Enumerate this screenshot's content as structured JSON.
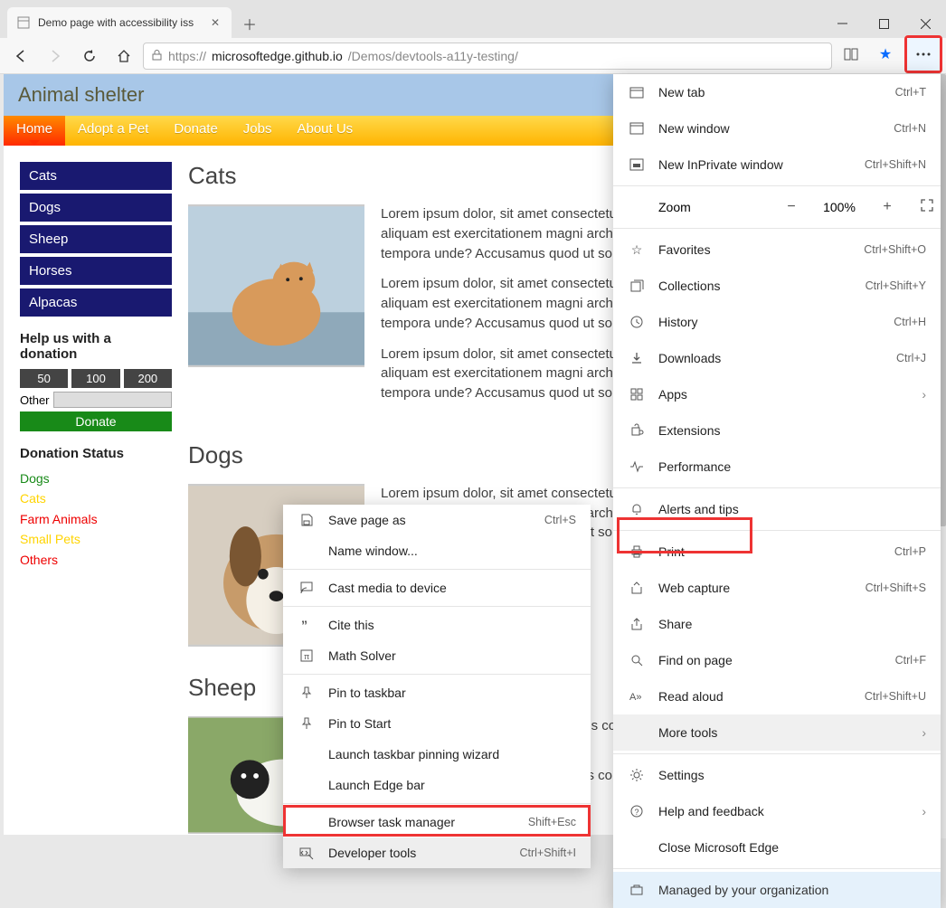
{
  "tab": {
    "title": "Demo page with accessibility iss"
  },
  "url": {
    "host": "microsoftedge.github.io",
    "path": "/Demos/devtools-a11y-testing/",
    "prefix": "https://"
  },
  "siteHeader": "Animal shelter",
  "nav": [
    "Home",
    "Adopt a Pet",
    "Donate",
    "Jobs",
    "About Us"
  ],
  "sidebar": [
    "Cats",
    "Dogs",
    "Sheep",
    "Horses",
    "Alpacas"
  ],
  "donationHeading": "Help us with a donation",
  "donationAmounts": [
    "50",
    "100",
    "200"
  ],
  "otherLabel": "Other",
  "donateLabel": "Donate",
  "donationStatusHeading": "Donation Status",
  "donationStatus": [
    {
      "label": "Dogs",
      "cls": "ds-green"
    },
    {
      "label": "Cats",
      "cls": "ds-yellow"
    },
    {
      "label": "Farm Animals",
      "cls": "ds-red"
    },
    {
      "label": "Small Pets",
      "cls": "ds-yellow"
    },
    {
      "label": "Others",
      "cls": "ds-red"
    }
  ],
  "sections": {
    "cats": {
      "h": "Cats",
      "p": "Lorem ipsum dolor, sit amet consectetur adipisicing elit. Obcaecati quos corrupti ratione a aliquam est exercitationem magni architecto dignissimos distinctio rem eligendi vitae tempora unde? Accusamus quod ut soluta voluptatum."
    },
    "dogs": {
      "h": "Dogs",
      "p": "Lorem ipsum dolor, sit amet consectetur adipisicing elit. Obcaecati quos corrupti ratione a aliquam est exercitationem magni architecto dignissimos distinctio rem eligendi vitae tempora unde? Accusamus quod ut soluta voluptatum."
    },
    "sheep": {
      "h": "Sheep",
      "p1": "tetur adipisicing elit. Obcaecati quos corrupti magni architecto dignissimos distinctio rem mus quod ut soluta voluptatum.",
      "p2": "etur adipisicing elit. Obcaecati quos corrupti magni architecto dignissimos distinctio rem"
    }
  },
  "mainMenu": {
    "newTab": {
      "label": "New tab",
      "short": "Ctrl+T"
    },
    "newWindow": {
      "label": "New window",
      "short": "Ctrl+N"
    },
    "newInPrivate": {
      "label": "New InPrivate window",
      "short": "Ctrl+Shift+N"
    },
    "zoom": {
      "label": "Zoom",
      "value": "100%"
    },
    "favorites": {
      "label": "Favorites",
      "short": "Ctrl+Shift+O"
    },
    "collections": {
      "label": "Collections",
      "short": "Ctrl+Shift+Y"
    },
    "history": {
      "label": "History",
      "short": "Ctrl+H"
    },
    "downloads": {
      "label": "Downloads",
      "short": "Ctrl+J"
    },
    "apps": {
      "label": "Apps"
    },
    "extensions": {
      "label": "Extensions"
    },
    "performance": {
      "label": "Performance"
    },
    "alerts": {
      "label": "Alerts and tips"
    },
    "print": {
      "label": "Print",
      "short": "Ctrl+P"
    },
    "capture": {
      "label": "Web capture",
      "short": "Ctrl+Shift+S"
    },
    "share": {
      "label": "Share"
    },
    "find": {
      "label": "Find on page",
      "short": "Ctrl+F"
    },
    "readAloud": {
      "label": "Read aloud",
      "short": "Ctrl+Shift+U"
    },
    "moreTools": {
      "label": "More tools"
    },
    "settings": {
      "label": "Settings"
    },
    "help": {
      "label": "Help and feedback"
    },
    "close": {
      "label": "Close Microsoft Edge"
    },
    "managed": {
      "label": "Managed by your organization"
    }
  },
  "subMenu": {
    "savePage": {
      "label": "Save page as",
      "short": "Ctrl+S"
    },
    "nameWindow": {
      "label": "Name window..."
    },
    "cast": {
      "label": "Cast media to device"
    },
    "cite": {
      "label": "Cite this"
    },
    "math": {
      "label": "Math Solver"
    },
    "pinTaskbar": {
      "label": "Pin to taskbar"
    },
    "pinStart": {
      "label": "Pin to Start"
    },
    "launchWizard": {
      "label": "Launch taskbar pinning wizard"
    },
    "launchEdgeBar": {
      "label": "Launch Edge bar"
    },
    "taskManager": {
      "label": "Browser task manager",
      "short": "Shift+Esc"
    },
    "devTools": {
      "label": "Developer tools",
      "short": "Ctrl+Shift+I"
    }
  }
}
